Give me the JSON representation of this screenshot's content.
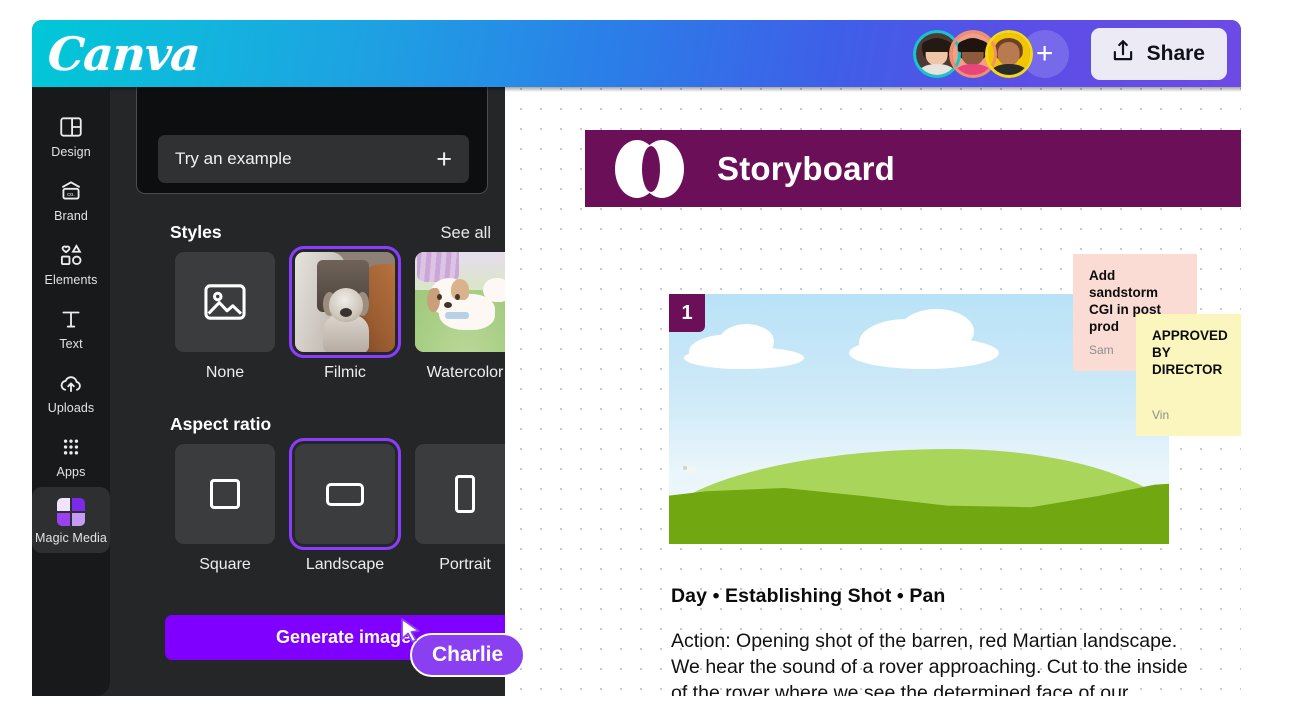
{
  "app": {
    "brand": "Canva"
  },
  "topbar": {
    "share_label": "Share",
    "share_icon": "share-upload-icon",
    "add_collaborator_icon": "plus-icon",
    "collaborators": [
      {
        "name": "collaborator-1",
        "ring_color": "#16c6c9",
        "bg": "#4e3a34",
        "skin": "#f0c6a8",
        "hair": "#241a14",
        "shirt": "#e8e3dc"
      },
      {
        "name": "collaborator-2",
        "ring_color": "#f2906c",
        "bg": "#f0a089",
        "skin": "#8e5a3d",
        "hair": "#201410",
        "shirt": "#e8457d"
      },
      {
        "name": "collaborator-3",
        "ring_color": "#f5d914",
        "bg": "#f3c400",
        "skin": "#b87a4e",
        "hair": "#6b4228",
        "shirt": "#2a2a2a"
      }
    ]
  },
  "sidebar": {
    "items": [
      {
        "label": "Design",
        "icon": "layout-design-icon",
        "active": false
      },
      {
        "label": "Brand",
        "icon": "brand-box-icon",
        "active": false
      },
      {
        "label": "Elements",
        "icon": "shapes-elements-icon",
        "active": false
      },
      {
        "label": "Text",
        "icon": "text-t-icon",
        "active": false
      },
      {
        "label": "Uploads",
        "icon": "cloud-upload-icon",
        "active": false
      },
      {
        "label": "Apps",
        "icon": "grid-apps-icon",
        "active": false
      },
      {
        "label": "Magic Media",
        "icon": "magic-media-icon",
        "active": true
      }
    ]
  },
  "left_panel": {
    "prompt": {
      "example_chip_label": "Try an example",
      "example_chip_icon": "plus-icon"
    },
    "styles": {
      "title": "Styles",
      "see_all_label": "See all",
      "options": [
        {
          "label": "None",
          "selected": false,
          "thumb": "image-placeholder-icon"
        },
        {
          "label": "Filmic",
          "selected": true,
          "thumb": "filmic-dog-photo"
        },
        {
          "label": "Watercolor",
          "selected": false,
          "thumb": "watercolor-dog-illustration"
        }
      ]
    },
    "aspect_ratio": {
      "title": "Aspect ratio",
      "options": [
        {
          "label": "Square",
          "selected": false,
          "icon": "square-ratio-icon"
        },
        {
          "label": "Landscape",
          "selected": true,
          "icon": "landscape-ratio-icon"
        },
        {
          "label": "Portrait",
          "selected": false,
          "icon": "portrait-ratio-icon"
        }
      ]
    },
    "generate_button_label": "Generate image"
  },
  "cursor": {
    "name": "Charlie",
    "color": "#8a3ff0"
  },
  "canvas": {
    "banner": {
      "title": "Storyboard",
      "logo": "double-oval-logo",
      "background_color": "#6b0f58"
    },
    "frame": {
      "number": "1",
      "heading": "Day • Establishing Shot • Pan",
      "action": "Action: Opening shot of the barren, red Martian landscape. We hear the sound of a rover approaching. Cut to the inside of the rover where we see the determined face of our"
    },
    "sticky_notes": [
      {
        "text": "Add sandstorm\nCGI in post prod",
        "author": "Sam",
        "color": "#fadcd5"
      },
      {
        "text": "APPROVED BY\nDIRECTOR",
        "author": "Vin",
        "color": "#fbf6bd"
      }
    ]
  },
  "colors": {
    "accent_purple": "#8b3dff",
    "generate_purple": "#8000ff",
    "banner_plum": "#6b0f58",
    "panel_dark": "#252627",
    "rail_dark": "#18191b"
  }
}
